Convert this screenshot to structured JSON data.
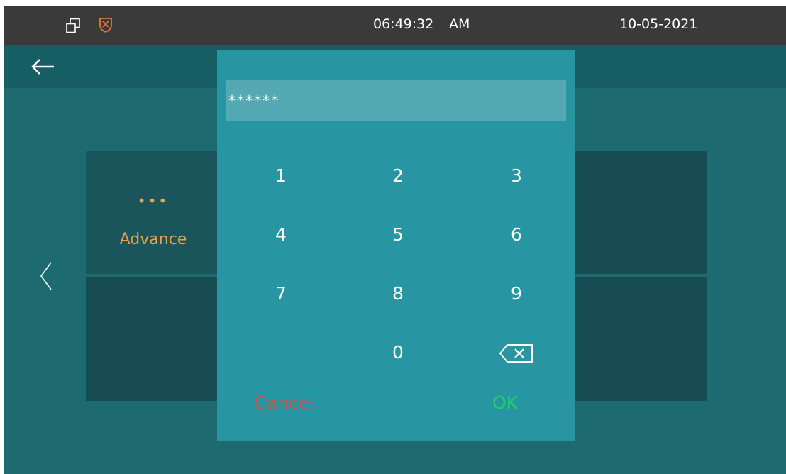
{
  "status_bar": {
    "time": "06:49:32",
    "ampm": "AM",
    "date": "10-05-2021"
  },
  "icons": {
    "back": "arrow-left-icon",
    "prev": "chevron-left-icon",
    "backspace": "backspace-icon",
    "multiwindow": "multi-window-icon",
    "shield": "shield-icon"
  },
  "tiles": {
    "advance": {
      "dots": "•••",
      "label": "Advance"
    }
  },
  "dialog": {
    "password_value": "******",
    "keys": [
      "1",
      "2",
      "3",
      "4",
      "5",
      "6",
      "7",
      "8",
      "9",
      "0"
    ],
    "cancel_label": "Cancel",
    "ok_label": "OK"
  },
  "colors": {
    "background": "#1e6a71",
    "status_bar": "#3a3a3a",
    "title_bar": "#165e64",
    "dialog": "#2896a2",
    "input": "#55a9b4",
    "tile_dark": "#164c52",
    "accent_orange": "#e8a04c",
    "cancel_red": "#c05a4e",
    "ok_green": "#22d066",
    "shield_orange": "#e07a38"
  }
}
